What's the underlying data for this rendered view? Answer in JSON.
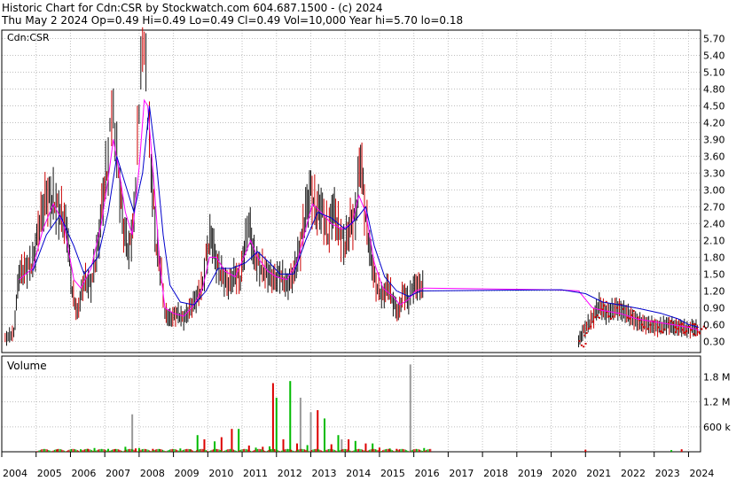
{
  "header": {
    "line1": "Historic Chart for Cdn:CSR by Stockwatch.com 604.687.1500 - (c) 2024",
    "line2": "Thu May  2 2024  Op=0.49  Hi=0.49  Lo=0.49  Cl=0.49  Vol=10,000  Year hi=5.70  lo=0.18"
  },
  "chart_data": [
    {
      "type": "line",
      "title": "Cdn:CSR",
      "ylim": [
        0.1,
        5.85
      ],
      "yticks": [
        5.7,
        5.4,
        5.1,
        4.8,
        4.5,
        4.2,
        3.9,
        3.6,
        3.3,
        3.0,
        2.7,
        2.4,
        2.1,
        1.8,
        1.5,
        1.2,
        0.9,
        0.6,
        0.3
      ],
      "ytick_labels": [
        "5.70",
        "5.40",
        "5.10",
        "4.80",
        "4.50",
        "4.20",
        "3.90",
        "3.60",
        "3.30",
        "3.00",
        "2.70",
        "2.40",
        "2.10",
        "1.80",
        "1.50",
        "1.20",
        "0.90",
        "0.60",
        "0.30"
      ],
      "xlim": [
        2004.0,
        2024.35
      ],
      "xtick_labels": [
        "2004",
        "2005",
        "2006",
        "2007",
        "2008",
        "2009",
        "2010",
        "2011",
        "2012",
        "2013",
        "2014",
        "2015",
        "2016",
        "2017",
        "2018",
        "2019",
        "2020",
        "2021",
        "2022",
        "2023",
        "2024"
      ],
      "xticks": [
        2004,
        2005,
        2006,
        2007,
        2008,
        2009,
        2010,
        2011,
        2012,
        2013,
        2014,
        2015,
        2016,
        2017,
        2018,
        2019,
        2020,
        2021,
        2022,
        2023,
        2024
      ],
      "grid": true,
      "price": [
        [
          2004.1,
          0.35
        ],
        [
          2004.35,
          0.45
        ],
        [
          2004.5,
          1.5
        ],
        [
          2004.9,
          1.7
        ],
        [
          2005.1,
          2.4
        ],
        [
          2005.3,
          2.9
        ],
        [
          2005.5,
          2.8
        ],
        [
          2005.7,
          2.6
        ],
        [
          2005.9,
          2.3
        ],
        [
          2006.05,
          1.2
        ],
        [
          2006.2,
          0.8
        ],
        [
          2006.4,
          1.4
        ],
        [
          2006.6,
          1.3
        ],
        [
          2006.8,
          2.0
        ],
        [
          2006.95,
          2.9
        ],
        [
          2007.1,
          3.5
        ],
        [
          2007.2,
          4.5
        ],
        [
          2007.3,
          4.0
        ],
        [
          2007.4,
          3.3
        ],
        [
          2007.55,
          2.3
        ],
        [
          2007.7,
          1.9
        ],
        [
          2007.85,
          2.5
        ],
        [
          2007.95,
          3.8
        ],
        [
          2008.05,
          5.2
        ],
        [
          2008.15,
          5.7
        ],
        [
          2008.25,
          4.4
        ],
        [
          2008.35,
          3.4
        ],
        [
          2008.5,
          2.0
        ],
        [
          2008.65,
          1.5
        ],
        [
          2008.75,
          0.8
        ],
        [
          2008.9,
          0.7
        ],
        [
          2009.1,
          0.8
        ],
        [
          2009.3,
          0.7
        ],
        [
          2009.5,
          0.9
        ],
        [
          2009.7,
          1.1
        ],
        [
          2009.85,
          1.3
        ],
        [
          2009.95,
          1.8
        ],
        [
          2010.1,
          2.2
        ],
        [
          2010.25,
          1.7
        ],
        [
          2010.4,
          1.5
        ],
        [
          2010.6,
          1.3
        ],
        [
          2010.8,
          1.5
        ],
        [
          2010.95,
          1.4
        ],
        [
          2011.1,
          2.1
        ],
        [
          2011.2,
          2.4
        ],
        [
          2011.35,
          1.8
        ],
        [
          2011.55,
          1.6
        ],
        [
          2011.75,
          1.5
        ],
        [
          2011.95,
          1.4
        ],
        [
          2012.1,
          1.5
        ],
        [
          2012.3,
          1.3
        ],
        [
          2012.5,
          1.5
        ],
        [
          2012.7,
          2.0
        ],
        [
          2012.85,
          2.6
        ],
        [
          2013.0,
          3.0
        ],
        [
          2013.15,
          2.6
        ],
        [
          2013.3,
          2.7
        ],
        [
          2013.5,
          2.2
        ],
        [
          2013.65,
          2.7
        ],
        [
          2013.8,
          2.3
        ],
        [
          2014.0,
          2.0
        ],
        [
          2014.15,
          2.4
        ],
        [
          2014.3,
          2.5
        ],
        [
          2014.45,
          3.6
        ],
        [
          2014.6,
          2.5
        ],
        [
          2014.75,
          1.8
        ],
        [
          2014.9,
          1.3
        ],
        [
          2015.1,
          1.1
        ],
        [
          2015.25,
          1.3
        ],
        [
          2015.4,
          1.0
        ],
        [
          2015.55,
          0.8
        ],
        [
          2015.7,
          1.2
        ],
        [
          2015.85,
          1.0
        ],
        [
          2015.95,
          1.25
        ],
        [
          2016.1,
          1.3
        ],
        [
          2016.3,
          1.25
        ],
        [
          2020.8,
          0.3
        ],
        [
          2020.95,
          0.5
        ],
        [
          2021.2,
          0.7
        ],
        [
          2021.4,
          0.95
        ],
        [
          2021.6,
          0.8
        ],
        [
          2021.9,
          0.9
        ],
        [
          2022.2,
          0.8
        ],
        [
          2022.5,
          0.65
        ],
        [
          2022.8,
          0.6
        ],
        [
          2023.1,
          0.55
        ],
        [
          2023.4,
          0.6
        ],
        [
          2023.6,
          0.55
        ],
        [
          2023.8,
          0.55
        ],
        [
          2024.0,
          0.5
        ],
        [
          2024.1,
          0.55
        ],
        [
          2024.3,
          0.5
        ]
      ],
      "ma_short": [
        [
          2004.5,
          1.4
        ],
        [
          2004.9,
          1.6
        ],
        [
          2005.2,
          2.3
        ],
        [
          2005.5,
          2.75
        ],
        [
          2005.8,
          2.4
        ],
        [
          2006.1,
          1.4
        ],
        [
          2006.3,
          1.25
        ],
        [
          2006.6,
          1.6
        ],
        [
          2006.9,
          2.4
        ],
        [
          2007.1,
          3.2
        ],
        [
          2007.25,
          3.9
        ],
        [
          2007.4,
          3.4
        ],
        [
          2007.6,
          2.6
        ],
        [
          2007.8,
          2.2
        ],
        [
          2008.0,
          3.4
        ],
        [
          2008.15,
          4.6
        ],
        [
          2008.25,
          4.5
        ],
        [
          2008.45,
          3.0
        ],
        [
          2008.6,
          1.7
        ],
        [
          2008.75,
          0.9
        ],
        [
          2009.0,
          0.8
        ],
        [
          2009.3,
          0.75
        ],
        [
          2009.6,
          0.95
        ],
        [
          2009.85,
          1.25
        ],
        [
          2010.05,
          1.8
        ],
        [
          2010.25,
          1.8
        ],
        [
          2010.5,
          1.55
        ],
        [
          2010.8,
          1.45
        ],
        [
          2011.05,
          1.8
        ],
        [
          2011.25,
          2.1
        ],
        [
          2011.45,
          1.8
        ],
        [
          2011.75,
          1.55
        ],
        [
          2012.0,
          1.45
        ],
        [
          2012.3,
          1.4
        ],
        [
          2012.6,
          1.7
        ],
        [
          2012.85,
          2.3
        ],
        [
          2013.05,
          2.75
        ],
        [
          2013.3,
          2.6
        ],
        [
          2013.6,
          2.4
        ],
        [
          2013.9,
          2.3
        ],
        [
          2014.2,
          2.4
        ],
        [
          2014.4,
          2.9
        ],
        [
          2014.6,
          2.6
        ],
        [
          2014.85,
          1.7
        ],
        [
          2015.1,
          1.25
        ],
        [
          2015.4,
          1.1
        ],
        [
          2015.6,
          0.95
        ],
        [
          2015.85,
          1.05
        ],
        [
          2016.05,
          1.2
        ],
        [
          2016.3,
          1.25
        ],
        [
          2020.1,
          1.22
        ],
        [
          2020.8,
          1.2
        ],
        [
          2021.2,
          0.9
        ],
        [
          2021.5,
          0.85
        ],
        [
          2022.0,
          0.8
        ],
        [
          2022.5,
          0.7
        ],
        [
          2023.0,
          0.65
        ],
        [
          2023.5,
          0.6
        ],
        [
          2024.0,
          0.55
        ],
        [
          2024.3,
          0.5
        ]
      ],
      "ma_long": [
        [
          2004.9,
          1.55
        ],
        [
          2005.3,
          2.2
        ],
        [
          2005.7,
          2.55
        ],
        [
          2006.1,
          2.0
        ],
        [
          2006.4,
          1.5
        ],
        [
          2006.8,
          1.8
        ],
        [
          2007.1,
          2.6
        ],
        [
          2007.35,
          3.6
        ],
        [
          2007.6,
          3.1
        ],
        [
          2007.85,
          2.6
        ],
        [
          2008.1,
          3.3
        ],
        [
          2008.3,
          4.5
        ],
        [
          2008.5,
          3.5
        ],
        [
          2008.7,
          2.2
        ],
        [
          2008.9,
          1.3
        ],
        [
          2009.2,
          1.0
        ],
        [
          2009.6,
          0.95
        ],
        [
          2009.95,
          1.2
        ],
        [
          2010.3,
          1.6
        ],
        [
          2010.7,
          1.6
        ],
        [
          2011.1,
          1.7
        ],
        [
          2011.45,
          1.9
        ],
        [
          2011.8,
          1.7
        ],
        [
          2012.1,
          1.5
        ],
        [
          2012.5,
          1.5
        ],
        [
          2012.85,
          2.1
        ],
        [
          2013.2,
          2.6
        ],
        [
          2013.6,
          2.5
        ],
        [
          2014.0,
          2.3
        ],
        [
          2014.35,
          2.5
        ],
        [
          2014.6,
          2.7
        ],
        [
          2014.85,
          2.0
        ],
        [
          2015.15,
          1.45
        ],
        [
          2015.5,
          1.2
        ],
        [
          2015.85,
          1.1
        ],
        [
          2016.2,
          1.2
        ],
        [
          2020.3,
          1.22
        ],
        [
          2021.0,
          1.15
        ],
        [
          2021.5,
          1.0
        ],
        [
          2022.0,
          0.95
        ],
        [
          2022.6,
          0.88
        ],
        [
          2023.2,
          0.8
        ],
        [
          2023.7,
          0.7
        ],
        [
          2024.0,
          0.6
        ],
        [
          2024.3,
          0.55
        ]
      ]
    },
    {
      "type": "bar",
      "title": "Volume",
      "ylim": [
        0,
        2300000
      ],
      "yticks": [
        1800000,
        1200000,
        600000
      ],
      "ytick_labels": [
        "1.8 M",
        "1.2 M",
        "600 k"
      ],
      "series": [
        {
          "color": "#00bb00",
          "values": [
            [
              2006.3,
              60000
            ],
            [
              2006.7,
              90000
            ],
            [
              2007.1,
              70000
            ],
            [
              2007.6,
              120000
            ],
            [
              2008.0,
              90000
            ],
            [
              2008.6,
              60000
            ],
            [
              2009.2,
              80000
            ],
            [
              2009.7,
              400000
            ],
            [
              2010.2,
              250000
            ],
            [
              2010.9,
              550000
            ],
            [
              2011.4,
              100000
            ],
            [
              2011.8,
              130000
            ],
            [
              2012.0,
              1300000
            ],
            [
              2012.4,
              1700000
            ],
            [
              2012.9,
              160000
            ],
            [
              2013.4,
              800000
            ],
            [
              2013.8,
              400000
            ],
            [
              2014.3,
              260000
            ],
            [
              2014.8,
              200000
            ],
            [
              2015.3,
              80000
            ],
            [
              2016.3,
              90000
            ],
            [
              2023.5,
              40000
            ]
          ]
        },
        {
          "color": "#dd0000",
          "values": [
            [
              2005.6,
              50000
            ],
            [
              2006.5,
              70000
            ],
            [
              2007.3,
              60000
            ],
            [
              2007.9,
              80000
            ],
            [
              2008.4,
              70000
            ],
            [
              2009.5,
              60000
            ],
            [
              2009.9,
              300000
            ],
            [
              2010.4,
              350000
            ],
            [
              2010.7,
              550000
            ],
            [
              2011.2,
              150000
            ],
            [
              2011.6,
              120000
            ],
            [
              2011.9,
              1650000
            ],
            [
              2012.2,
              300000
            ],
            [
              2012.6,
              200000
            ],
            [
              2013.0,
              600000
            ],
            [
              2013.2,
              1000000
            ],
            [
              2013.6,
              180000
            ],
            [
              2014.1,
              300000
            ],
            [
              2014.6,
              200000
            ],
            [
              2015.0,
              100000
            ],
            [
              2015.5,
              70000
            ],
            [
              2021.0,
              50000
            ],
            [
              2023.8,
              60000
            ]
          ]
        },
        {
          "color": "#999999",
          "values": [
            [
              2007.8,
              900000
            ],
            [
              2012.7,
              1300000
            ],
            [
              2013.0,
              950000
            ],
            [
              2013.9,
              300000
            ],
            [
              2015.9,
              2100000
            ]
          ]
        }
      ]
    }
  ]
}
